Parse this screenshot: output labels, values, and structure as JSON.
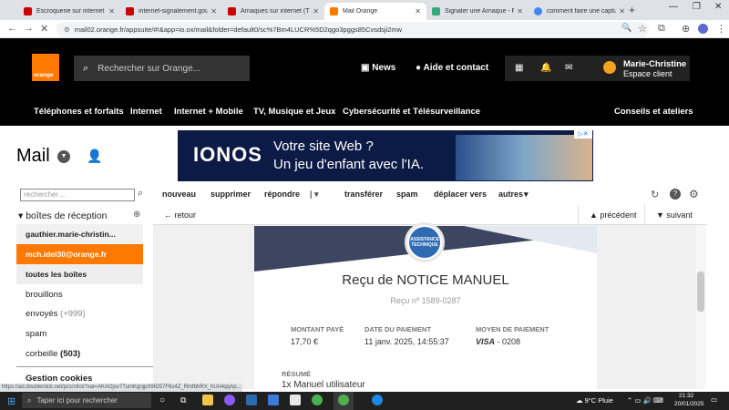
{
  "browser": {
    "tabs": [
      {
        "title": "Escroquerie sur internet : qu",
        "favicon": "flag-icon",
        "color": "#c00"
      },
      {
        "title": "internet-signalement.gouv.fr",
        "favicon": "flag-icon",
        "color": "#c00"
      },
      {
        "title": "Arnaques sur internet (THESE",
        "favicon": "flag-icon",
        "color": "#c00"
      },
      {
        "title": "Mail Orange",
        "favicon": "mail-icon",
        "color": "#ff7900"
      },
      {
        "title": "Signaler une Arnaque - Form",
        "favicon": "plugin-icon",
        "color": "#3a7"
      },
      {
        "title": "comment faire une capture",
        "favicon": "google-icon",
        "color": "#4285f4"
      }
    ],
    "new_tab": "+",
    "url": "mail02.orange.fr/appsuite/#!&app=io.ox/mail&folder=default0/sc%7Bm4LUCR%5D2qgo3pggs85Cvsdsji2mw"
  },
  "header": {
    "logo": "orange",
    "search_placeholder": "Rechercher sur Orange...",
    "news": "News",
    "help": "Aide et contact",
    "user_name": "Marie-Christine",
    "user_sub": "Espace client",
    "menu": [
      "Téléphones et forfaits",
      "Internet",
      "Internet + Mobile",
      "TV, Musique et Jeux",
      "Cybersécurité et Télésurveillance",
      "Conseils et ateliers"
    ]
  },
  "mail": {
    "title": "Mail",
    "search_placeholder": "rechercher ...",
    "toolbar": [
      "nouveau",
      "supprimer",
      "répondre",
      "transférer",
      "spam",
      "déplacer vers",
      "autres"
    ],
    "inbox_header": "boîtes de réception",
    "accounts": [
      "gauthier.marie-christin...",
      "mch.idel30@orange.fr"
    ],
    "folders": [
      {
        "name": "toutes les boîtes",
        "count": ""
      },
      {
        "name": "brouillons",
        "count": ""
      },
      {
        "name": "envoyés",
        "count": "(+999)"
      },
      {
        "name": "spam",
        "count": ""
      },
      {
        "name": "corbeille",
        "count": "(503)"
      }
    ],
    "manage": "Gestion cookies",
    "back": "retour",
    "prev": "précédent",
    "next": "suivant"
  },
  "ad": {
    "brand": "IONOS",
    "line1": "Votre site Web ?",
    "line2": "Un jeu d'enfant avec l'IA."
  },
  "email": {
    "badge": "ASSISTANCE TECHNIQUE",
    "heading": "Reçu de NOTICE MANUEL",
    "receipt_no": "Reçu nº 1589-0287",
    "amount_label": "MONTANT PAYÉ",
    "amount": "17,70 €",
    "date_label": "DATE DU PAIEMENT",
    "date": "11 janv. 2025, 14:55:37",
    "method_label": "MOYEN DE PAIEMENT",
    "method_brand": "VISA",
    "method_digits": "- 0208",
    "summary_label": "RÉSUMÉ",
    "summary_item": "1x Manuel utilisateur"
  },
  "status_url": "https://ad.doubleclick.net/pcs/click?xai=AKAOjsv7TumKgnjpX9ID57F6s4Z_RmfbhRX_hUn4qqAp...",
  "taskbar": {
    "search_placeholder": "Taper ici pour rechercher",
    "weather": "9°C  Pluie",
    "time": "21:32",
    "date": "20/01/2025"
  }
}
